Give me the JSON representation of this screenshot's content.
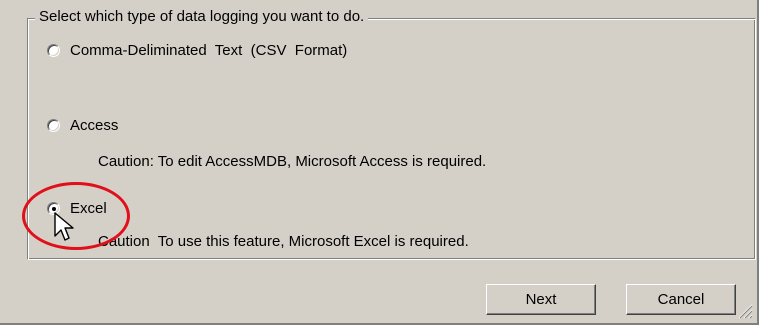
{
  "group": {
    "legend": "Select which type of data logging you want to do."
  },
  "options": [
    {
      "label": "Comma-Deliminated  Text  (CSV  Format)",
      "checked": false
    },
    {
      "label": "Access",
      "checked": false,
      "caution": "Caution: To edit AccessMDB, Microsoft Access is required."
    },
    {
      "label": "Excel",
      "checked": true,
      "caution": "Caution  To use this feature, Microsoft Excel is required."
    }
  ],
  "buttons": {
    "next_label": "Next",
    "cancel_label": "Cancel"
  },
  "colors": {
    "dialog_bg": "#d4d0c8",
    "highlight": "#e0101a"
  },
  "icons": [
    "radio-icon",
    "mouse-pointer-icon",
    "resize-grip-icon"
  ]
}
